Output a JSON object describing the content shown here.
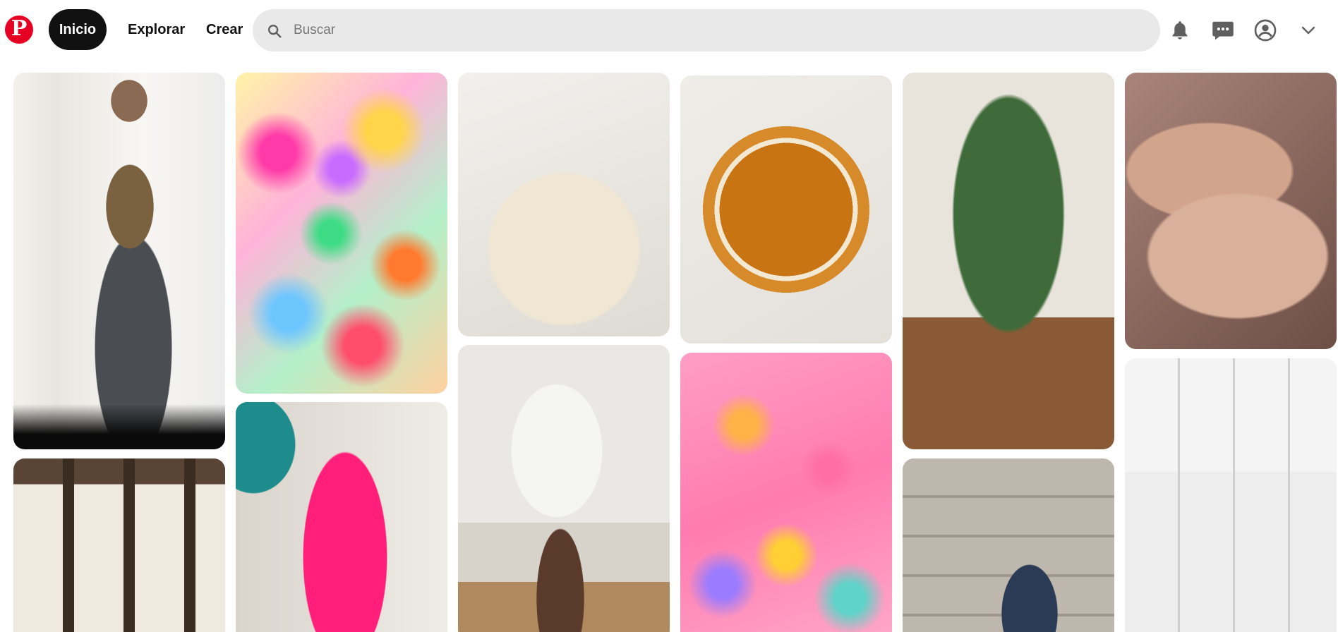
{
  "header": {
    "logo_letter": "P",
    "nav": {
      "home": "Inicio",
      "explore": "Explorar",
      "create": "Crear"
    },
    "search": {
      "placeholder": "Buscar",
      "value": ""
    },
    "icons": [
      "bell-icon",
      "chat-icon",
      "profile-icon",
      "chevron-down-icon"
    ]
  },
  "colors": {
    "brand": "#e60023",
    "nav_active_bg": "#111111",
    "search_bg": "#e9e9e9"
  }
}
